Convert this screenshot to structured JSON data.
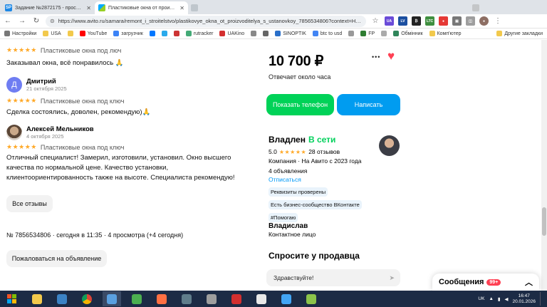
{
  "browser": {
    "tabs": [
      {
        "label": "Задание №2872175 - просмотр з",
        "favicon_text": "SP",
        "favicon_color": "#1e88e5",
        "active": false
      },
      {
        "label": "Пластиковые окна от производ",
        "favicon_text": "",
        "favicon_color": "#00aaff",
        "active": true
      },
      {
        "label": "",
        "favicon_text": "",
        "favicon_color": "#9aa",
        "active": false
      }
    ],
    "url": "https://www.avito.ru/samara/remont_i_stroitelstvo/plastikovye_okna_ot_proizvoditelya_s_ustanovkoy_7856534806?context=H4sIAAAA...",
    "bookmarks": [
      "Настройки",
      "USA",
      "",
      "YouTube",
      "загрузчик",
      "",
      "",
      "",
      "rutracker",
      "UAKino",
      "",
      "",
      "SINOPTIK",
      "btc to usd",
      "",
      "FP",
      "",
      "Обмінник",
      "Комп'ютер",
      "Другие закладки"
    ]
  },
  "reviews": [
    {
      "name": "",
      "date": "",
      "stars": "★★★★★",
      "meta": "Пластиковые окна под люч",
      "text": "Заказывал окна, всё понравилось 🙏"
    },
    {
      "name": "Дмитрий",
      "date": "21 октября 2025",
      "avatar_letter": "Д",
      "stars": "★★★★★",
      "meta": "Пластиковые окна под ключ",
      "text": "Сделка состоялись, доволен, рекомендую)🙏"
    },
    {
      "name": "Алексей Мельников",
      "date": "4 октября 2025",
      "stars": "★★★★★",
      "meta": "Пластиковые окна под ключ",
      "text": "Отличный специалист! Замерил, изготовили, установил. Окно высшего качества по нормальной цене. Качество установки, клиентоориентированность также на высоте. Специалиста рекомендую!"
    }
  ],
  "all_reviews_button": "Все отзывы",
  "listing_info": "№ 7856534806 · сегодня в 11:35 · 4 просмотра (+4 сегодня)",
  "complain_button": "Пожаловаться на объявление",
  "price": "10 700 ₽",
  "more_label": "•••",
  "response_time": "Отвечает около часа",
  "show_phone_button": "Показать телефон",
  "write_button": "Написать",
  "seller": {
    "name": "Владлен",
    "status": "В сети",
    "rating": "5.0",
    "stars": "★★★★★",
    "reviews_count": "28 отзывов",
    "company_line": "Компания · На Авито с 2023 года",
    "ads_count": "4 объявления",
    "unsubscribe": "Отписаться",
    "badges": [
      "Реквизиты проверены",
      "Есть бизнес-сообщество ВКонтакте",
      "#Помогаю"
    ]
  },
  "contact": {
    "name": "Владислав",
    "role": "Контактное лицо"
  },
  "ask_title": "Спросите у продавца",
  "ask_placeholder": "Здравствуйте!",
  "messages": {
    "label": "Сообщения",
    "count": "99+"
  },
  "taskbar": {
    "lang": "UK",
    "time": "16:47",
    "date": "20.01.2026"
  },
  "colors": {
    "green": "#00d258",
    "blue": "#009cf0",
    "online": "#02d15c",
    "link": "#0099f7",
    "star": "#ffa928",
    "heart": "#ff4053"
  }
}
